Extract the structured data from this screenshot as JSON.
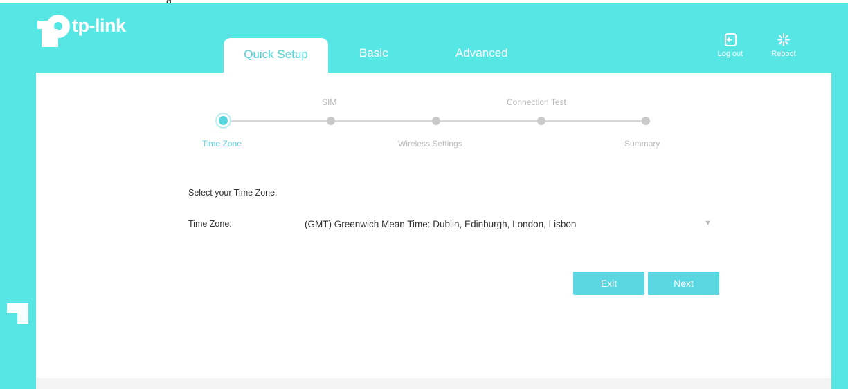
{
  "brand": {
    "name": "tp-link"
  },
  "top_partial_text": "g",
  "tabs": [
    {
      "label": "Quick Setup",
      "active": true
    },
    {
      "label": "Basic",
      "active": false
    },
    {
      "label": "Advanced",
      "active": false
    }
  ],
  "toolbar": {
    "logout": {
      "label": "Log out",
      "icon": "logout-icon"
    },
    "reboot": {
      "label": "Reboot",
      "icon": "reboot-icon"
    }
  },
  "stepper": {
    "steps": [
      {
        "label": "Time Zone",
        "active": true
      },
      {
        "label": "SIM",
        "active": false
      },
      {
        "label": "Wireless Settings",
        "active": false
      },
      {
        "label": "Connection Test",
        "active": false
      },
      {
        "label": "Summary",
        "active": false
      }
    ]
  },
  "form": {
    "prompt": "Select your Time Zone.",
    "time_zone_label": "Time Zone:",
    "time_zone_value": "(GMT) Greenwich Mean Time: Dublin, Edinburgh, London, Lisbon"
  },
  "buttons": {
    "exit": "Exit",
    "next": "Next"
  },
  "colors": {
    "frame": "#56e6e4",
    "accent": "#58d5dd",
    "button": "#5ad7e0"
  }
}
